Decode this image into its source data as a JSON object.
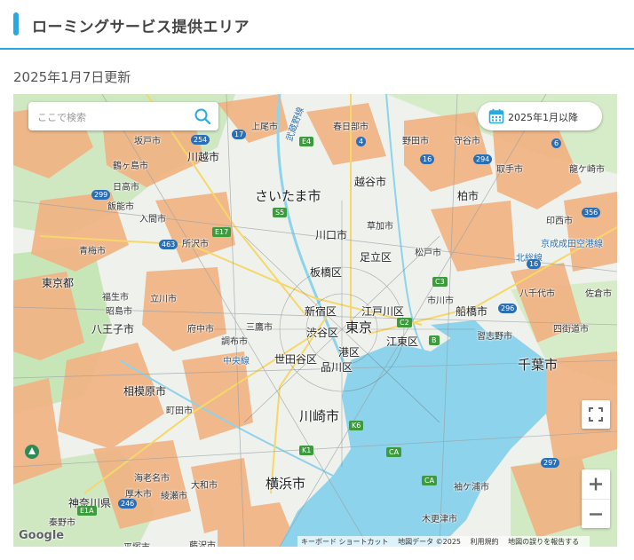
{
  "header": {
    "title": "ローミングサービス提供エリア"
  },
  "updated": "2025年1月7日更新",
  "search": {
    "placeholder": "ここで検索",
    "icon": "search-icon"
  },
  "date_filter": {
    "label": "2025年1月以降",
    "icon": "calendar-icon"
  },
  "map": {
    "colors": {
      "coverage": "#f2b282",
      "water": "#8dd3eb",
      "land": "#eef1ec",
      "green": "#c6e6b8",
      "accent": "#29a9e0"
    },
    "labels": {
      "saitama": "さいたま市",
      "kawaguchi": "川口市",
      "itabashi": "板橋区",
      "adachi": "足立区",
      "shinjuku": "新宿区",
      "tokyo": "東京",
      "edogawa": "江戸川区",
      "koto": "江東区",
      "shibuya": "渋谷区",
      "minato": "港区",
      "setagaya": "世田谷区",
      "shinagawa": "品川区",
      "kawasaki": "川崎市",
      "yokohama": "横浜市",
      "chiba": "千葉市",
      "funabashi": "船橋市",
      "hachioji": "八王子市",
      "sagamihara": "相模原市",
      "kanagawa": "神奈川県",
      "tokyoto": "東京都",
      "kawagoe": "川越市",
      "koshigaya": "越谷市",
      "kashiwa": "柏市",
      "matsudo": "松戸市",
      "ichikawa": "市川市",
      "narashino": "習志野市",
      "tokorozawa": "所沢市",
      "fuchu": "府中市",
      "chofu": "調布市",
      "machida": "町田市",
      "soka": "草加市",
      "kasukabe": "春日部市",
      "ageo": "上尾市",
      "noda": "野田市",
      "moriya": "守谷市",
      "toride": "取手市",
      "ryugasaki": "龍ケ崎市",
      "inzai": "印西市",
      "yachiyo": "八千代市",
      "sakura": "佐倉市",
      "yotsukaido": "四街道市",
      "sodegaura": "袖ケ浦市",
      "kisarazu": "木更津市",
      "sakado": "坂戸市",
      "tsurugashima": "鶴ヶ島市",
      "hidaka": "日高市",
      "hanno": "飯能市",
      "iruma": "入間市",
      "ome": "青梅市",
      "fussa": "福生市",
      "akishima": "昭島市",
      "tachikawa": "立川市",
      "mitaka": "三鷹市",
      "ebina": "海老名市",
      "atsugi": "厚木市",
      "ayase": "綾瀬市",
      "yamato": "大和市",
      "hadano": "秦野市",
      "hiratsuka": "平塚市",
      "fujisawa": "藤沢市",
      "kitanarita": "北総線",
      "keisei": "京成成田空港線",
      "chuo": "中央線",
      "musashino": "武蔵野線"
    }
  },
  "controls": {
    "fullscreen_icon": "fullscreen-icon",
    "zoom_in": "+",
    "zoom_out": "−"
  },
  "attribution": {
    "logo": "Google",
    "shortcuts": "キーボード ショートカット",
    "map_data": "地図データ ©2025",
    "terms": "利用規約",
    "report": "地図の誤りを報告する"
  }
}
